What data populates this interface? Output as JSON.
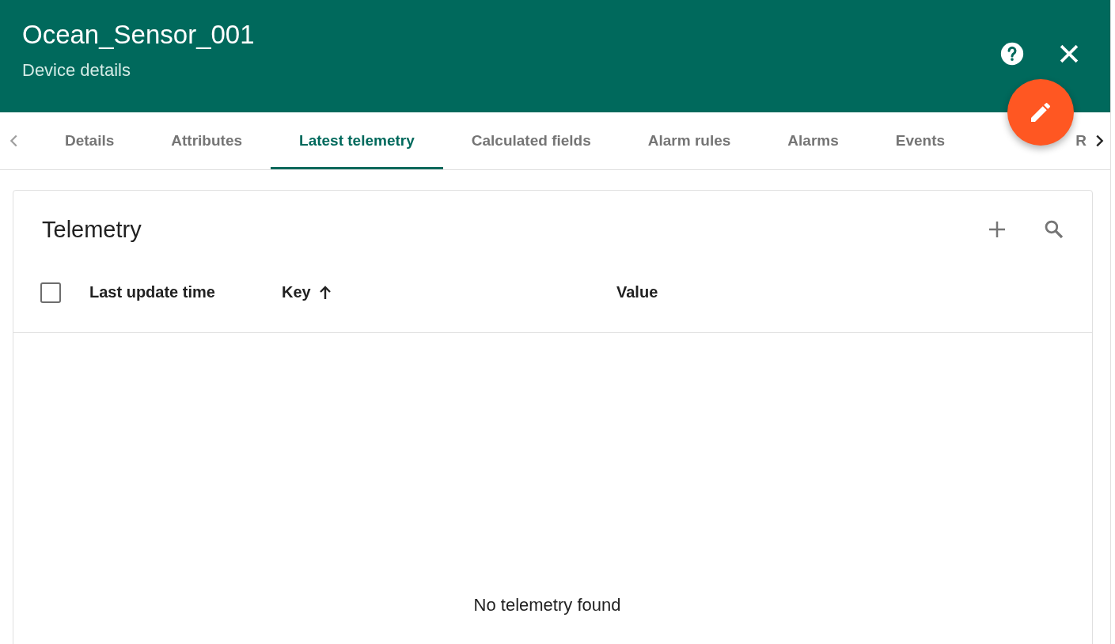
{
  "header": {
    "title": "Ocean_Sensor_001",
    "subtitle": "Device details"
  },
  "tabs": [
    {
      "label": "Details",
      "selected": false
    },
    {
      "label": "Attributes",
      "selected": false
    },
    {
      "label": "Latest telemetry",
      "selected": true
    },
    {
      "label": "Calculated fields",
      "selected": false
    },
    {
      "label": "Alarm rules",
      "selected": false
    },
    {
      "label": "Alarms",
      "selected": false
    },
    {
      "label": "Events",
      "selected": false
    },
    {
      "label": "R",
      "selected": false
    }
  ],
  "card": {
    "title": "Telemetry",
    "table": {
      "select_all": {
        "checked": false
      },
      "columns": [
        {
          "label": "Last update time",
          "sorted": false
        },
        {
          "label": "Key",
          "sorted": true
        },
        {
          "label": "Value",
          "sorted": false
        }
      ],
      "empty_message": "No telemetry found"
    }
  }
}
